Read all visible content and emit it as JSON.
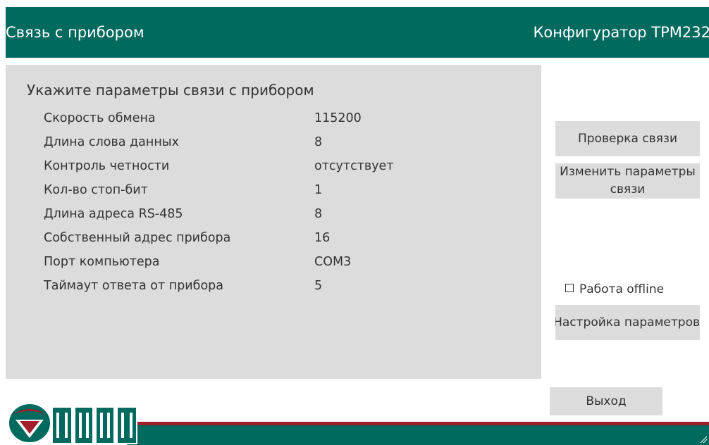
{
  "header": {
    "title": "Связь с прибором",
    "app_name": "Конфигуратор ТРМ232"
  },
  "panel": {
    "heading": "Укажите параметры связи с прибором",
    "rows": [
      {
        "label": "Скорость обмена",
        "value": "115200"
      },
      {
        "label": "Длина слова данных",
        "value": "8"
      },
      {
        "label": "Контроль четности",
        "value": "отсутствует"
      },
      {
        "label": "Кол-во стоп-бит",
        "value": "1"
      },
      {
        "label": "Длина адреса RS-485",
        "value": "8"
      },
      {
        "label": "Собственный адрес прибора",
        "value": "16"
      },
      {
        "label": "Порт компьютера",
        "value": "COM3"
      },
      {
        "label": "Таймаут ответа от прибора",
        "value": "5"
      }
    ]
  },
  "buttons": {
    "check": "Проверка связи",
    "change_line1": "Изменить параметры",
    "change_line2": "связи",
    "settings": "Настройка параметров",
    "exit": "Выход"
  },
  "offline": {
    "label": "Работа offline",
    "checked": false
  },
  "colors": {
    "brand_green": "#006a5e",
    "brand_red": "#a01f2b",
    "panel_gray": "#dcdcdc"
  },
  "icons": {
    "logo": "oven-logo",
    "resize": "resize-grip-icon"
  }
}
